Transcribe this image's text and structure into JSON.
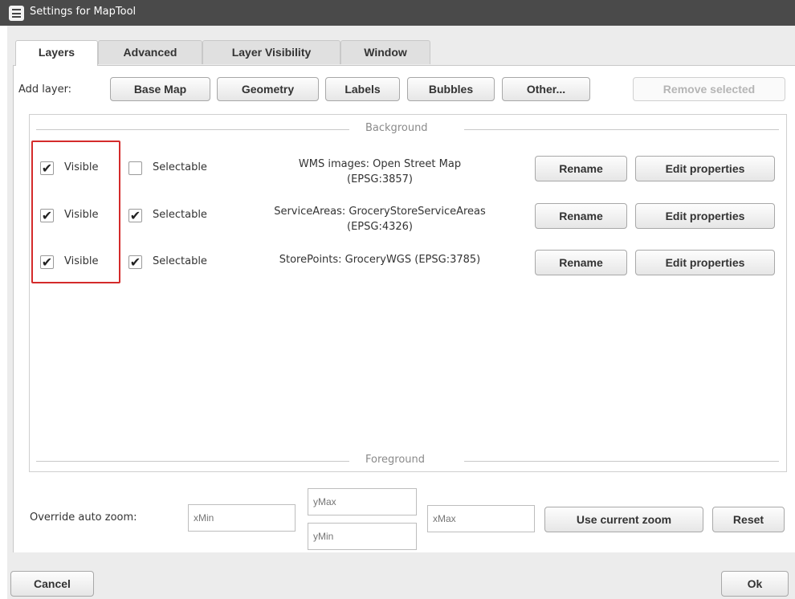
{
  "window": {
    "title": "Settings for MapTool"
  },
  "tabs": [
    "Layers",
    "Advanced",
    "Layer Visibility",
    "Window"
  ],
  "add_layer": {
    "label": "Add layer:",
    "buttons": [
      "Base Map",
      "Geometry",
      "Labels",
      "Bubbles",
      "Other..."
    ],
    "remove_label": "Remove selected"
  },
  "sections": {
    "background": "Background",
    "foreground": "Foreground"
  },
  "layers": [
    {
      "visible_label": "Visible",
      "visible": true,
      "selectable_label": "Selectable",
      "selectable": false,
      "name_line1": "WMS images: Open Street Map",
      "name_line2": "(EPSG:3857)",
      "rename_label": "Rename",
      "edit_label": "Edit properties"
    },
    {
      "visible_label": "Visible",
      "visible": true,
      "selectable_label": "Selectable",
      "selectable": true,
      "name_line1": "ServiceAreas: GroceryStoreServiceAreas",
      "name_line2": "(EPSG:4326)",
      "rename_label": "Rename",
      "edit_label": "Edit properties"
    },
    {
      "visible_label": "Visible",
      "visible": true,
      "selectable_label": "Selectable",
      "selectable": true,
      "name_line1": "StorePoints: GroceryWGS (EPSG:3785)",
      "name_line2": "",
      "rename_label": "Rename",
      "edit_label": "Edit properties"
    }
  ],
  "zoom": {
    "label": "Override auto zoom:",
    "xmin_placeholder": "xMin",
    "ymax_placeholder": "yMax",
    "ymin_placeholder": "yMin",
    "xmax_placeholder": "xMax",
    "use_current_label": "Use current zoom",
    "reset_label": "Reset"
  },
  "footer": {
    "cancel_label": "Cancel",
    "ok_label": "Ok"
  },
  "colors": {
    "titlebar": "#4a4a4a",
    "highlight": "#d42b2b"
  },
  "checkmark": "✔"
}
